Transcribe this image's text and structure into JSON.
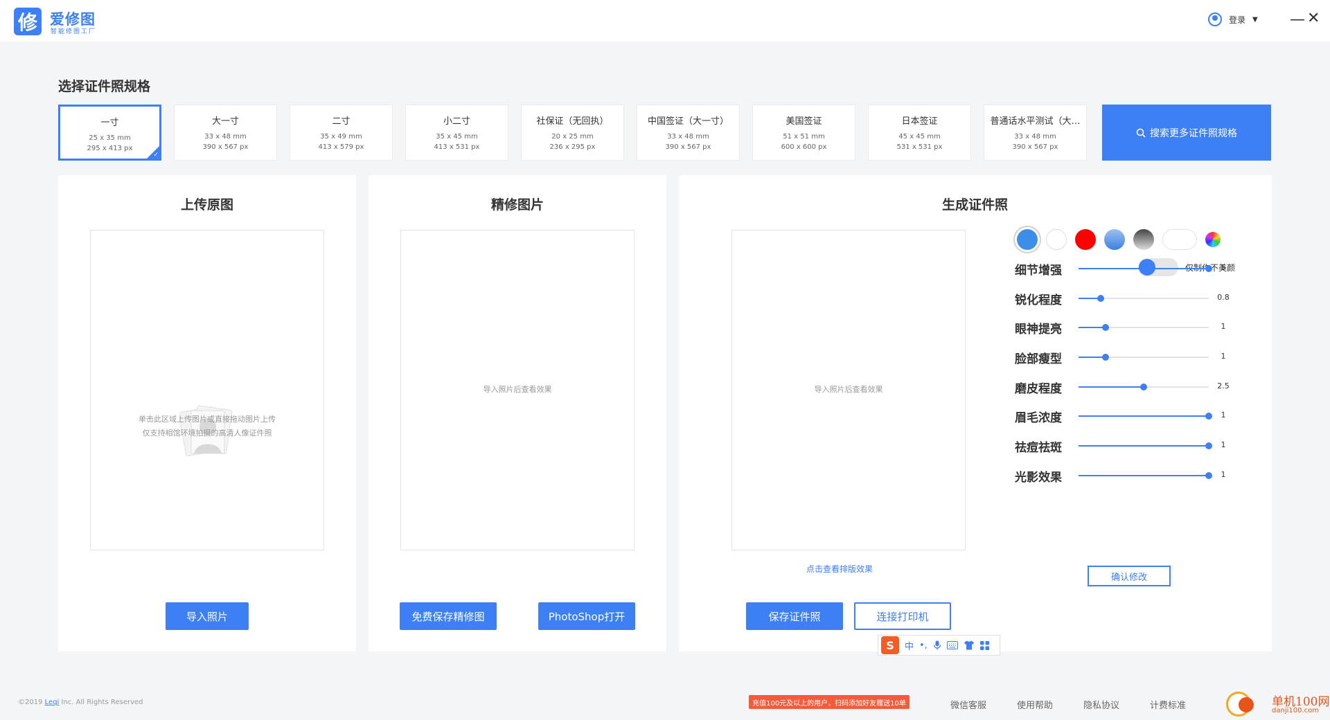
{
  "header": {
    "logo_glyph": "修",
    "app_name": "爱修图",
    "app_tagline": "智能修图工厂",
    "login_label": "登录",
    "minimize": "—",
    "close": "✕"
  },
  "specs": {
    "title": "选择证件照规格",
    "items": [
      {
        "name": "一寸",
        "mm": "25 x 35 mm",
        "px": "295 x 413 px",
        "selected": true
      },
      {
        "name": "大一寸",
        "mm": "33 x 48 mm",
        "px": "390 x 567 px"
      },
      {
        "name": "二寸",
        "mm": "35 x 49 mm",
        "px": "413 x 579 px"
      },
      {
        "name": "小二寸",
        "mm": "35 x 45 mm",
        "px": "413 x 531 px"
      },
      {
        "name": "社保证（无回执）",
        "mm": "20 x 25 mm",
        "px": "236 x 295 px"
      },
      {
        "name": "中国签证（大一寸）",
        "mm": "33 x 48 mm",
        "px": "390 x 567 px"
      },
      {
        "name": "美国签证",
        "mm": "51 x 51 mm",
        "px": "600 x 600 px"
      },
      {
        "name": "日本签证",
        "mm": "45 x 45 mm",
        "px": "531 x 531 px"
      },
      {
        "name": "普通话水平测试（大…",
        "mm": "33 x 48 mm",
        "px": "390 x 567 px"
      }
    ],
    "search_more": "搜索更多证件照规格"
  },
  "upload_panel": {
    "title": "上传原图",
    "hint_line1": "单击此区域上传图片或直接拖动图片上传",
    "hint_line2": "仅支持相馆环境拍摄的高清人像证件照",
    "import_button": "导入照片"
  },
  "retouch_panel": {
    "title": "精修图片",
    "hint": "导入照片后查看效果",
    "save_button": "免费保存精修图",
    "photoshop_button": "PhotoShop打开"
  },
  "generate_panel": {
    "title": "生成证件照",
    "hint": "导入照片后查看效果",
    "layout_link": "点击查看排版效果",
    "save_button": "保存证件照",
    "printer_button": "连接打印机",
    "beauty_only_label": "仅制作不美颜",
    "confirm_button": "确认修改",
    "colors": {
      "blue": "#3d8ee8",
      "white": "#ffffff",
      "red": "#ff0000",
      "blue_gradient": "#5b9be8",
      "gray_gradient": "#666666"
    },
    "sliders": [
      {
        "label": "细节增强",
        "value": "5",
        "level": 1.0
      },
      {
        "label": "锐化程度",
        "value": "0.8",
        "level": 0.17
      },
      {
        "label": "眼神提亮",
        "value": "1",
        "level": 0.21
      },
      {
        "label": "脸部瘦型",
        "value": "1",
        "level": 0.21
      },
      {
        "label": "磨皮程度",
        "value": "2.5",
        "level": 0.5
      },
      {
        "label": "眉毛浓度",
        "value": "1",
        "level": 1.0
      },
      {
        "label": "祛痘祛斑",
        "value": "1",
        "level": 1.0
      },
      {
        "label": "光影效果",
        "value": "1",
        "level": 1.0
      }
    ]
  },
  "ime": {
    "logo": "S",
    "mode": "中",
    "punct": "•,",
    "icons": [
      "mic-icon",
      "keyboard-icon",
      "shirt-icon",
      "grid-icon"
    ]
  },
  "footer": {
    "copyright_prefix": "©2019",
    "copyright_link": "Leqi",
    "copyright_suffix": "Inc. All Rights Reserved",
    "promo": "充值100元及以上的用户，扫码添加好友赠送10单",
    "links": [
      "微信客服",
      "使用帮助",
      "隐私协议",
      "计费标准"
    ],
    "watermark_title": "单机100网",
    "watermark_url": "danji100.com"
  }
}
